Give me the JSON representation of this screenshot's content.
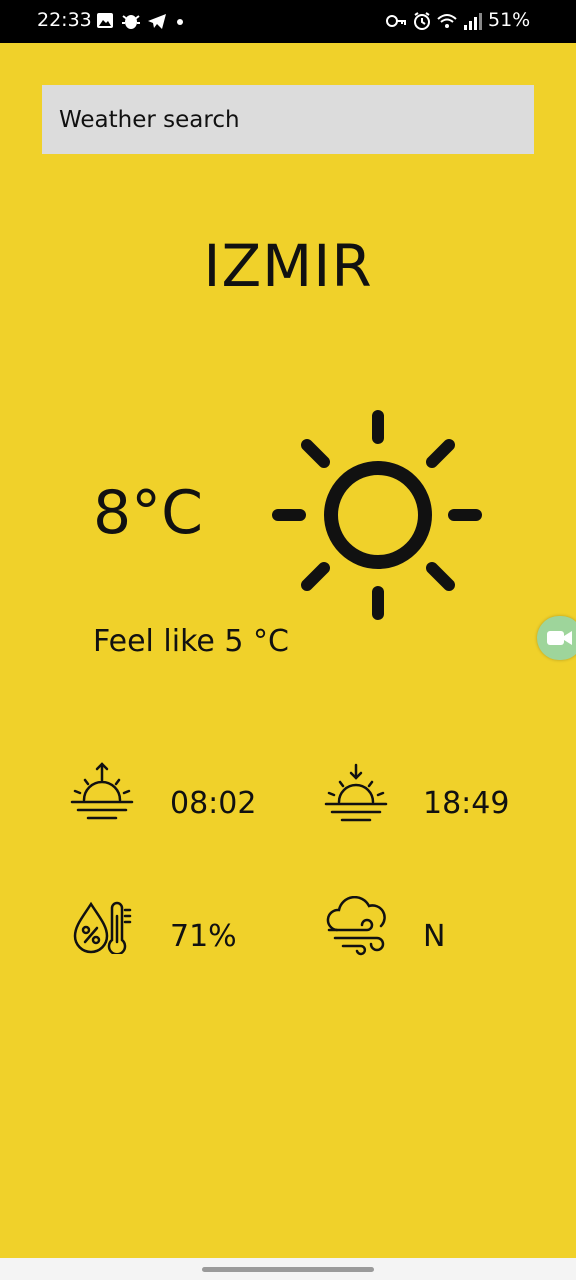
{
  "status_bar": {
    "time": "22:33",
    "battery": "51%",
    "left_icons": [
      "image-icon",
      "bug-icon",
      "telegram-icon",
      "dot-icon"
    ],
    "right_icons": [
      "key-icon",
      "alarm-icon",
      "wifi-icon",
      "signal-icon"
    ]
  },
  "search": {
    "placeholder": "Weather search"
  },
  "weather": {
    "city": "IZMIR",
    "temperature": "8°C",
    "feels_like": "Feel like 5 °C",
    "condition_icon": "sun-icon"
  },
  "details": {
    "sunrise": "08:02",
    "sunset": "18:49",
    "humidity": "71%",
    "wind": "N"
  },
  "colors": {
    "background": "#f0d12a",
    "search_bg": "#dcdcdc",
    "status_bar": "#000000",
    "fab": "#9ed59b"
  }
}
